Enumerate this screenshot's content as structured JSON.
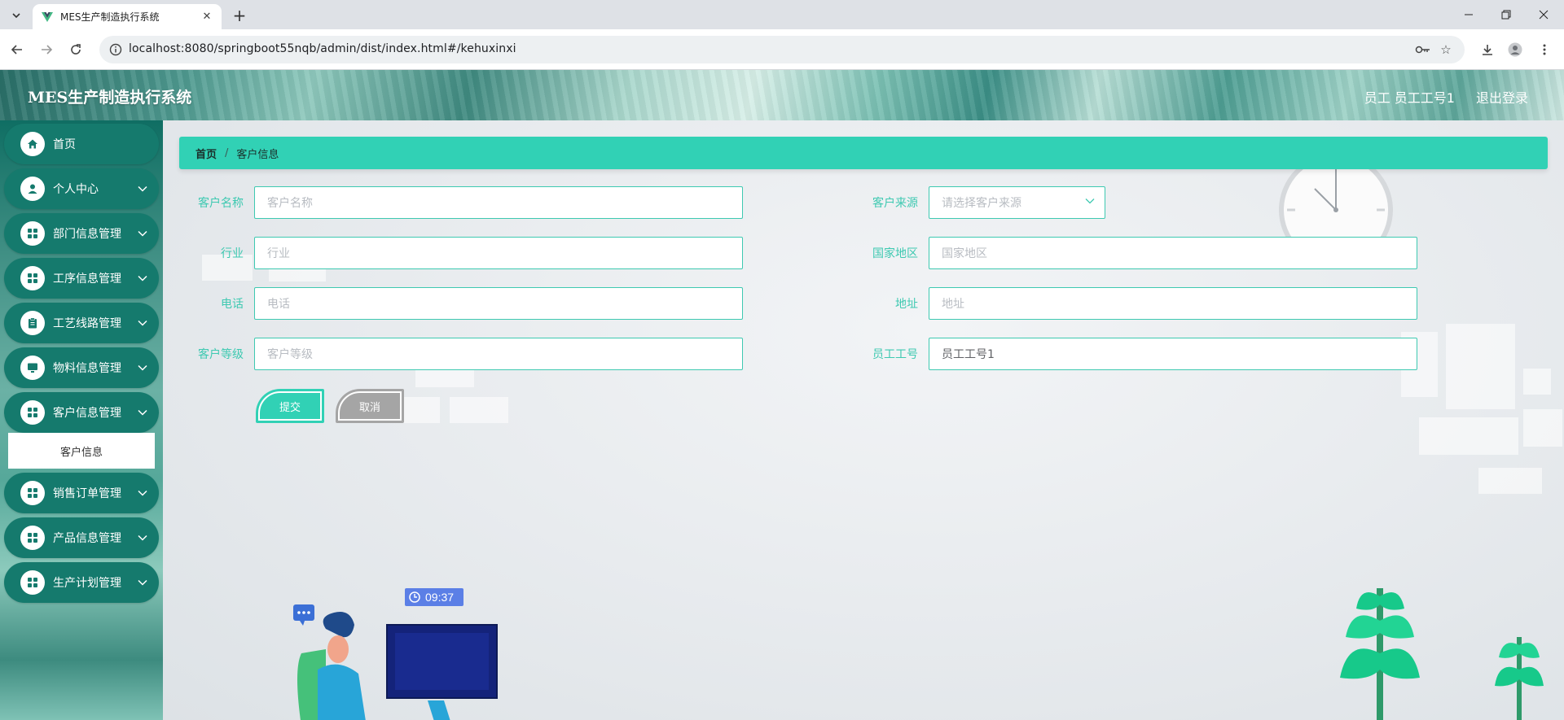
{
  "browser": {
    "tab_title": "MES生产制造执行系统",
    "url": "localhost:8080/springboot55nqb/admin/dist/index.html#/kehuxinxi"
  },
  "header": {
    "app_title": "MES生产制造执行系统",
    "user": "员工 员工工号1",
    "logout": "退出登录"
  },
  "sidebar": {
    "items": [
      {
        "label": "首页",
        "icon": "home-icon"
      },
      {
        "label": "个人中心",
        "icon": "user-icon"
      },
      {
        "label": "部门信息管理",
        "icon": "grid-icon"
      },
      {
        "label": "工序信息管理",
        "icon": "grid-icon"
      },
      {
        "label": "工艺线路管理",
        "icon": "clipboard-icon"
      },
      {
        "label": "物料信息管理",
        "icon": "monitor-icon"
      },
      {
        "label": "客户信息管理",
        "icon": "grid-icon"
      },
      {
        "label": "销售订单管理",
        "icon": "grid-icon"
      },
      {
        "label": "产品信息管理",
        "icon": "grid-icon"
      },
      {
        "label": "生产计划管理",
        "icon": "grid-icon"
      }
    ],
    "submenu": {
      "label": "客户信息"
    }
  },
  "breadcrumb": {
    "home": "首页",
    "separator": "/",
    "current": "客户信息"
  },
  "form": {
    "customer_name": {
      "label": "客户名称",
      "placeholder": "客户名称"
    },
    "customer_source": {
      "label": "客户来源",
      "placeholder": "请选择客户来源"
    },
    "industry": {
      "label": "行业",
      "placeholder": "行业"
    },
    "region": {
      "label": "国家地区",
      "placeholder": "国家地区"
    },
    "phone": {
      "label": "电话",
      "placeholder": "电话"
    },
    "address": {
      "label": "地址",
      "placeholder": "地址"
    },
    "customer_level": {
      "label": "客户等级",
      "placeholder": "客户等级"
    },
    "employee_id": {
      "label": "员工工号",
      "value": "员工工号1"
    },
    "submit": "提交",
    "cancel": "取消"
  },
  "illustration": {
    "time": "09:37"
  },
  "colors": {
    "accent": "#31d1b5",
    "sidebar_item": "#157a6d",
    "label": "#3ec9b1",
    "cancel": "#a5a5a5"
  }
}
